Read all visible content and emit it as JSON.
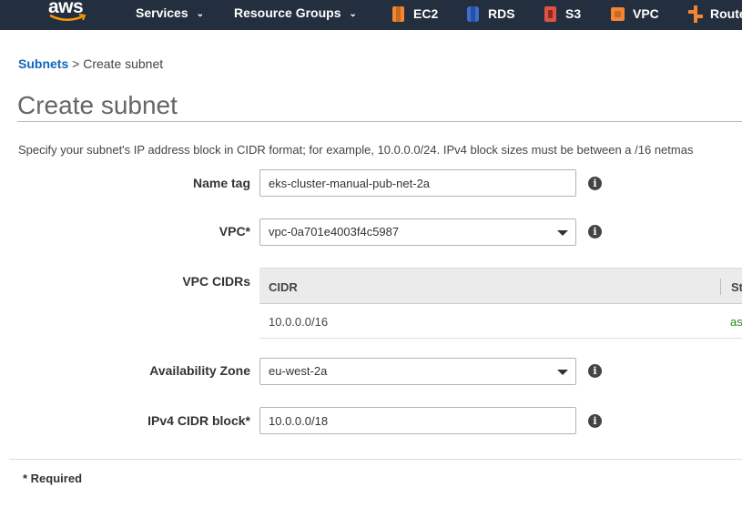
{
  "nav": {
    "services": "Services",
    "resource_groups": "Resource Groups",
    "items": [
      {
        "label": "EC2",
        "icon": "ec2-icon",
        "color": "#f58536"
      },
      {
        "label": "RDS",
        "icon": "rds-icon",
        "color": "#3b6fd1"
      },
      {
        "label": "S3",
        "icon": "s3-icon",
        "color": "#e05243"
      },
      {
        "label": "VPC",
        "icon": "vpc-icon",
        "color": "#f58536"
      },
      {
        "label": "Route",
        "icon": "route53-icon",
        "color": "#f58536"
      }
    ]
  },
  "breadcrumb": {
    "parent": "Subnets",
    "separator": ">",
    "current": "Create subnet"
  },
  "page": {
    "title": "Create subnet",
    "description": "Specify your subnet's IP address block in CIDR format; for example, 10.0.0.0/24. IPv4 block sizes must be between a /16 netmas"
  },
  "form": {
    "name_tag": {
      "label": "Name tag",
      "value": "eks-cluster-manual-pub-net-2a"
    },
    "vpc": {
      "label": "VPC*",
      "value": "vpc-0a701e4003f4c5987"
    },
    "vpc_cidrs": {
      "label": "VPC CIDRs",
      "columns": [
        "CIDR",
        "St"
      ],
      "rows": [
        {
          "cidr": "10.0.0.0/16",
          "status": "as"
        }
      ]
    },
    "az": {
      "label": "Availability Zone",
      "value": "eu-west-2a"
    },
    "ipv4": {
      "label": "IPv4 CIDR block*",
      "value": "10.0.0.0/18"
    },
    "info_icon": "i"
  },
  "footer": {
    "required": "* Required"
  }
}
